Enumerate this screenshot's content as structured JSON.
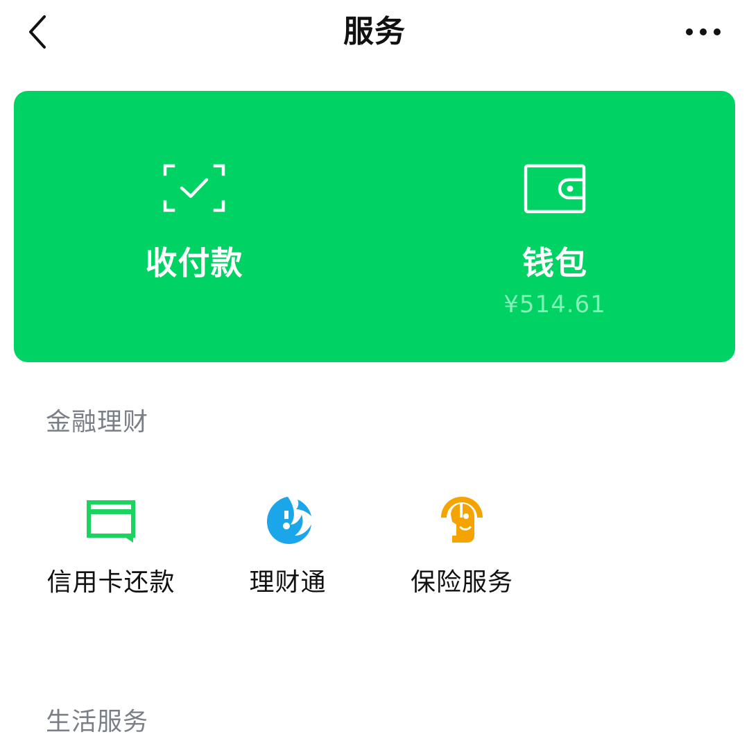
{
  "header": {
    "title": "服务",
    "back_icon": "chevron-left-icon",
    "more_icon": "more-horizontal-icon"
  },
  "card": {
    "background": "#00d364",
    "pay": {
      "label": "收付款",
      "icon": "scan-check-icon"
    },
    "wallet": {
      "label": "钱包",
      "balance": "¥514.61",
      "icon": "wallet-icon"
    }
  },
  "finance": {
    "title": "金融理财",
    "items": [
      {
        "label": "信用卡还款",
        "icon": "credit-card-icon",
        "color": "#1bd35f"
      },
      {
        "label": "理财通",
        "icon": "wealth-drop-icon",
        "color": "#1aa6e8"
      },
      {
        "label": "保险服务",
        "icon": "umbrella-face-icon",
        "color": "#f5a300"
      }
    ]
  },
  "life": {
    "title": "生活服务"
  }
}
